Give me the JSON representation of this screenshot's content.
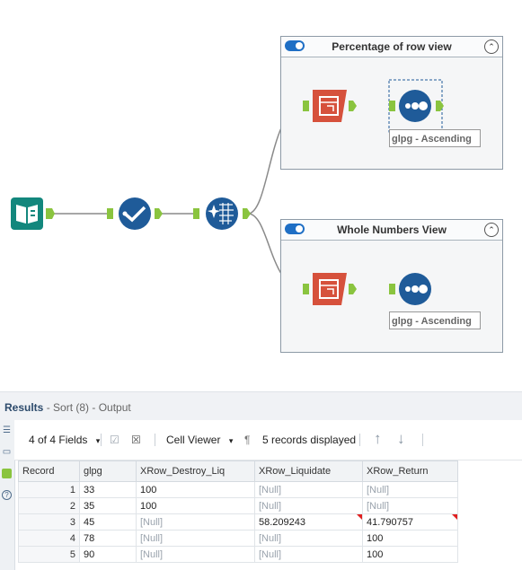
{
  "workflow": {
    "containers": [
      {
        "title": "Percentage of row view",
        "collapse_glyph": "⌃"
      },
      {
        "title": "Whole Numbers View",
        "collapse_glyph": "⌃"
      }
    ],
    "sort_labels": [
      "glpg - Ascending",
      "glpg - Ascending"
    ],
    "colors": {
      "input": "#13877d",
      "select": "#1f5b99",
      "multirow": "#1f5b99",
      "crosstab": "#d6513c",
      "sort": "#1f5b99",
      "connector": "#8ac43f"
    },
    "tools": {
      "input_icon": "book-icon",
      "select_icon": "checkmark-icon",
      "multirow_icon": "sparkle-grid-icon",
      "crosstab_icon": "table-arrow-icon",
      "sort_icon": "dots-icon"
    }
  },
  "results": {
    "title": "Results",
    "subtitle": "- Sort (8) - Output",
    "toolbar": {
      "fields": "4 of 4 Fields",
      "fields_caret": "▾",
      "viewer": "Cell Viewer",
      "viewer_caret": "▾",
      "pilcrow": "¶",
      "records": "5 records displayed",
      "up": "↑",
      "down": "↓"
    },
    "columns": [
      "Record",
      "glpg",
      "XRow_Destroy_Liq",
      "XRow_Liquidate",
      "XRow_Return"
    ],
    "rows": [
      [
        "1",
        "33",
        "100",
        "[Null]",
        "[Null]"
      ],
      [
        "2",
        "35",
        "100",
        "[Null]",
        "[Null]"
      ],
      [
        "3",
        "45",
        "[Null]",
        "58.209243",
        "41.790757"
      ],
      [
        "4",
        "78",
        "[Null]",
        "[Null]",
        "100"
      ],
      [
        "5",
        "90",
        "[Null]",
        "[Null]",
        "100"
      ]
    ]
  }
}
